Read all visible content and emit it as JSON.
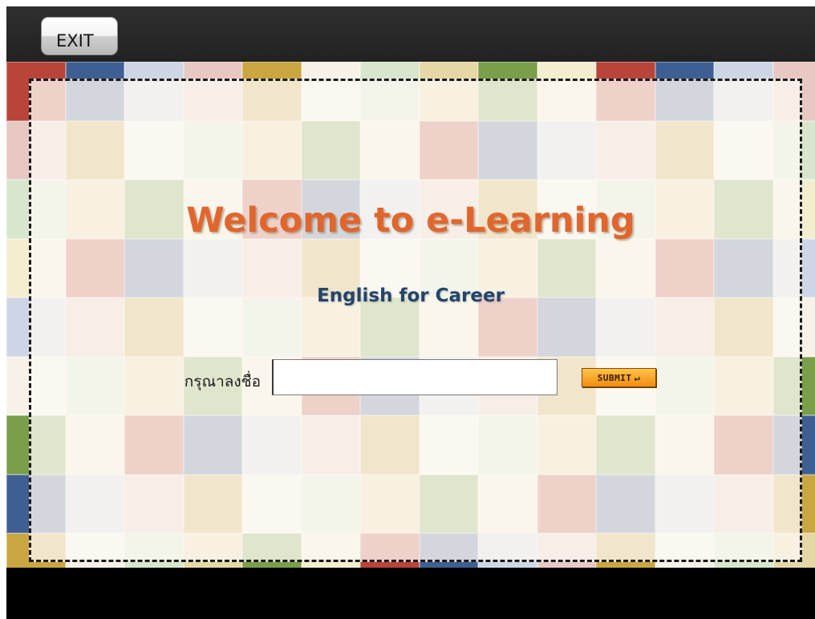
{
  "toolbar": {
    "exit_label": "EXIT"
  },
  "login": {
    "title": "Welcome to e-Learning",
    "subtitle": "English for Career",
    "name_label": "กรุณาลงชื่อ",
    "name_value": "",
    "name_placeholder": "",
    "submit_label": "SUBMIT",
    "submit_icon": "enter-arrow-icon",
    "submit_icon_glyph": "↵"
  },
  "colors": {
    "frame_background": "#000000",
    "top_bar": "#2a2a2a",
    "title": "#e0662e",
    "subtitle": "#24456b",
    "submit_background": "#f4a11f",
    "card_border": "#1a1a1a",
    "tile_palette": [
      "#b9443a",
      "#e7c8c3",
      "#d7e6cc",
      "#f3eecf",
      "#ced6e6",
      "#f7f1ea",
      "#7a9e4a",
      "#3f5f93",
      "#c9a640",
      "#e6d7a6"
    ]
  }
}
